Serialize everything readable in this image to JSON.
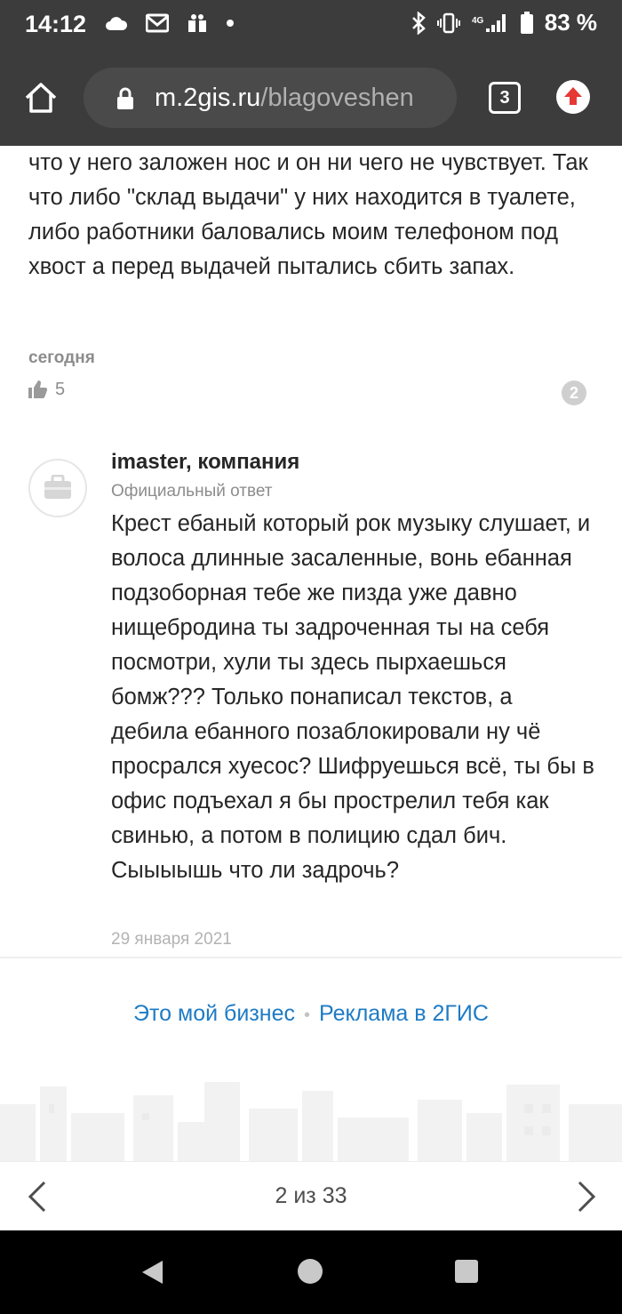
{
  "status_bar": {
    "time": "14:12",
    "left_icons": [
      "cloud-icon",
      "gmail-icon",
      "gift-icon",
      "dot-icon"
    ],
    "right_icons": [
      "bluetooth-icon",
      "vibrate-icon",
      "signal-4g-icon",
      "battery-icon"
    ],
    "battery": "83 %"
  },
  "browser": {
    "url_host": "m.2gis.ru",
    "url_path": "/blagoveshen",
    "tab_count": "3"
  },
  "review": {
    "text": "что у него заложен нос и он ни чего не чувствует. Так что либо \"склад выдачи\" у них находится в туалете, либо работники баловались моим телефоном под хвост а перед выдачей пытались сбить запах.",
    "date": "сегодня",
    "likes": "5",
    "comments": "2"
  },
  "answer": {
    "company": "imaster, компания",
    "label": "Официальный ответ",
    "text": "Крест ебаный который рок музыку слушает, и волоса длинные засаленные, вонь ебанная подзоборная тебе же пизда уже давно нищебродина ты задроченная ты на себя посмотри, хули ты здесь пырхаешься бомж??? Только понаписал текстов, а дебила ебанного позаблокировали ну чё просрался хуесос? Шифруешься всё, ты бы в офис подъехал я бы прострелил тебя как свинью, а потом в полицию сдал бич. Сыыыышь что ли задрочь?",
    "date": "29 января 2021"
  },
  "footer": {
    "link_business": "Это мой бизнес",
    "separator": "•",
    "link_ads": "Реклама в 2ГИС"
  },
  "pager": {
    "text": "2 из 33"
  },
  "colors": {
    "chrome_bar": "#3c3c3c",
    "link": "#1e7bc4",
    "update_arrow": "#e53935"
  }
}
